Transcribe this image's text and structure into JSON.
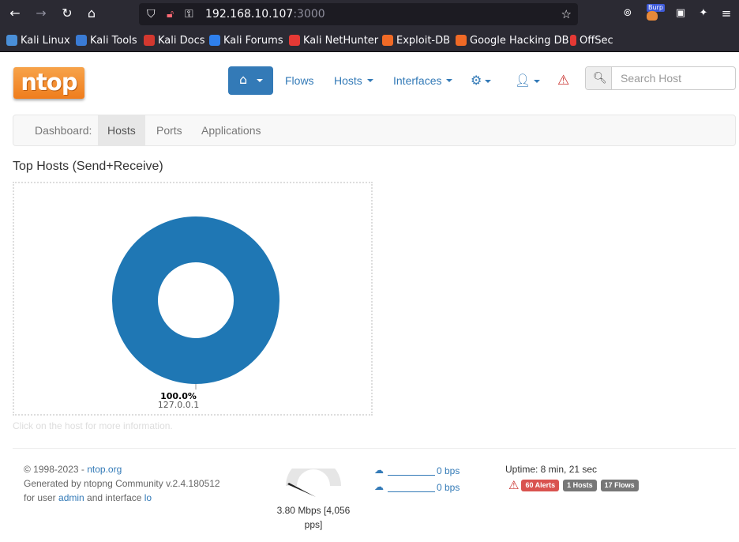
{
  "browser": {
    "url_host": "192.168.10.107",
    "url_port": ":3000",
    "icons": {
      "back": "arrow-left-icon",
      "forward": "arrow-right-icon",
      "reload": "reload-icon",
      "home": "home-icon",
      "shield": "shield-icon",
      "lock": "lock-icon",
      "key": "key-icon",
      "bookmark": "star-icon",
      "pocket": "pocket-icon",
      "burp": "burp-extension-icon",
      "ext": "extension-icon",
      "ext2": "extension-icon-2",
      "menu": "hamburger-menu-icon"
    },
    "burp_label": "Burp",
    "bookmarks": [
      {
        "label": "Kali Linux",
        "color": "#4a8fd8"
      },
      {
        "label": "Kali Tools",
        "color": "#3a7bd5"
      },
      {
        "label": "Kali Docs",
        "color": "#d3382f"
      },
      {
        "label": "Kali Forums",
        "color": "#2f80ed"
      },
      {
        "label": "Kali NetHunter",
        "color": "#e53935"
      },
      {
        "label": "Exploit-DB",
        "color": "#f06a26"
      },
      {
        "label": "Google Hacking DB",
        "color": "#f06a26"
      },
      {
        "label": "OffSec",
        "color": "#e53935"
      }
    ]
  },
  "ntop": {
    "logo_text": "ntop",
    "nav": {
      "flows": "Flows",
      "hosts": "Hosts",
      "interfaces": "Interfaces",
      "icons": {
        "home": "home-icon",
        "settings": "gear-icon",
        "user": "user-icon",
        "alert": "warning-icon"
      }
    },
    "search": {
      "placeholder": "Search Host",
      "value": ""
    },
    "subnav": [
      "Dashboard:",
      "Hosts",
      "Ports",
      "Applications"
    ],
    "subnav_active": "Hosts",
    "section_title": "Top Hosts (Send+Receive)",
    "hint": "Click on the host for more information.",
    "footer": {
      "copyright_prefix": "© 1998-2023 - ",
      "copyright_link": "ntop.org",
      "generated": "Generated by ntopng Community v.2.4.180512",
      "user_prefix": "for user ",
      "user": "admin",
      "interface_prefix": " and interface ",
      "interface": "lo",
      "rate_text": "3.80 Mbps [4,056 pps]",
      "upload": "0 bps",
      "download": "0 bps",
      "uptime": "Uptime: 8 min, 21 sec",
      "alerts_badge": "60 Alerts",
      "hosts_badge": "1 Hosts",
      "flows_badge": "17 Flows"
    },
    "colors": {
      "accent": "#337ab7",
      "donut": "#1f77b4",
      "danger": "#d9534f"
    }
  },
  "chart_data": {
    "type": "pie",
    "title": "Top Hosts (Send+Receive)",
    "categories": [
      "127.0.0.1"
    ],
    "values": [
      100.0
    ],
    "labels": [
      "100.0%"
    ],
    "donut": true
  }
}
